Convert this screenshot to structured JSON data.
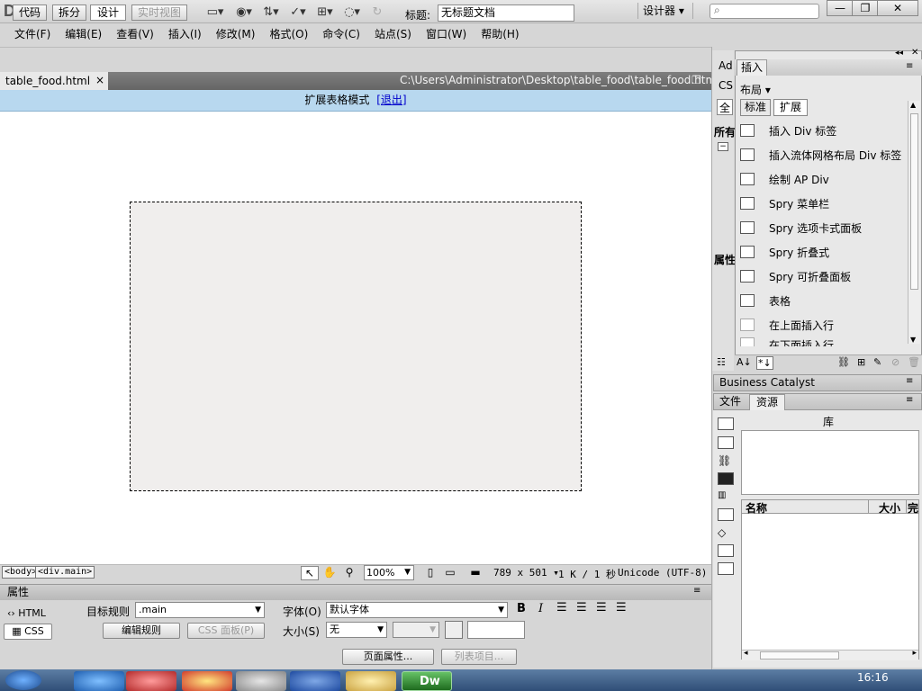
{
  "app": {
    "logo": "Dw",
    "workspace": "设计器 ▾"
  },
  "menu": [
    "文件(F)",
    "编辑(E)",
    "查看(V)",
    "插入(I)",
    "修改(M)",
    "格式(O)",
    "命令(C)",
    "站点(S)",
    "窗口(W)",
    "帮助(H)"
  ],
  "doc_toolbar": {
    "code": "代码",
    "split": "拆分",
    "design": "设计",
    "live": "实时视图",
    "title_label": "标题:",
    "title_value": "无标题文档"
  },
  "tab": {
    "filename": "table_food.html",
    "close": "×",
    "path": "C:\\Users\\Administrator\\Desktop\\table_food\\table_food.html"
  },
  "expanded_mode": {
    "text": "扩展表格模式",
    "exit": "[退出]"
  },
  "status": {
    "tag_body": "<body>",
    "tag_div": "<div.main>",
    "zoom": "100%",
    "dimensions": "789 x 501",
    "size_time": "1 K / 1 秒",
    "encoding": "Unicode (UTF-8)"
  },
  "properties": {
    "header": "属性",
    "html_btn": "HTML",
    "css_btn": "CSS",
    "target_rule_label": "目标规则",
    "target_rule_value": ".main",
    "edit_rule_btn": "编辑规则",
    "css_panel_btn": "CSS 面板(P)",
    "font_label": "字体(O)",
    "font_value": "默认字体",
    "size_label": "大小(S)",
    "size_value": "无",
    "page_props_btn": "页面属性...",
    "list_items_btn": "列表项目..."
  },
  "insert_panel": {
    "tab": "插入",
    "category": "布局",
    "subtab_standard": "标准",
    "subtab_extended": "扩展",
    "items": [
      "插入 Div 标签",
      "插入流体网格布局 Div 标签",
      "绘制 AP Div",
      "Spry 菜单栏",
      "Spry 选项卡式面板",
      "Spry 折叠式",
      "Spry 可折叠面板",
      "表格",
      "在上面插入行",
      "在下面插入行"
    ]
  },
  "left_strip": {
    "ad": "Ad",
    "cs": "CS",
    "all": "全",
    "all_label": "所有",
    "props": "属性"
  },
  "bc_panel": {
    "title": "Business Catalyst"
  },
  "files_panel": {
    "tab_files": "文件",
    "tab_assets": "资源",
    "library_label": "库",
    "col_name": "名称",
    "col_size": "大小",
    "col_full": "完"
  },
  "taskbar": {
    "clock": "16:16"
  }
}
